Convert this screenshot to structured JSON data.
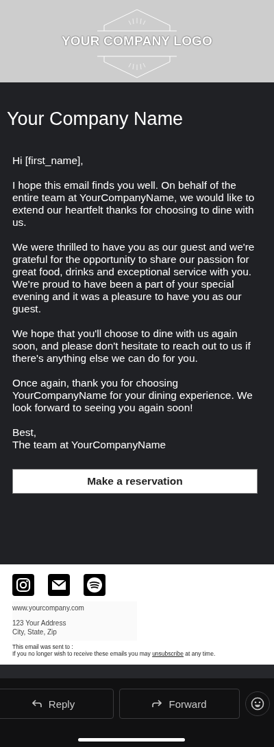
{
  "header": {
    "logo_text": "YOUR COMPANY LOGO"
  },
  "email": {
    "company_name": "Your Company Name",
    "paragraphs": [
      "Hi [first_name],",
      "I hope this email finds you well. On behalf of the entire team at YourCompanyName, we would like to extend our heartfelt thanks for choosing to dine with us.",
      "We were thrilled to have you as our guest and we're grateful for the opportunity to share our passion for great food, drinks and exceptional service with you. We're proud to have been a part of your special evening and it was a pleasure to have you as our guest.",
      "We hope that you'll choose to dine with us again soon, and please don't hesitate to reach out to us if there's anything else we can do for you.",
      "Once again, thank you for choosing YourCompanyName for your dining experience. We look forward to seeing you again soon!"
    ],
    "signoff": [
      "Best,",
      "The team at YourCompanyName"
    ],
    "cta": "Make a reservation"
  },
  "footer": {
    "social": [
      {
        "kind": "instagram"
      },
      {
        "kind": "mail"
      },
      {
        "kind": "spotify"
      }
    ],
    "website": "www.yourcompany.com",
    "address": [
      "123 Your Address",
      "City, State, Zip"
    ],
    "sent_to": "This email was sent to :",
    "unsubscribe_before": "If you no longer wish to receive these emails you may",
    "unsubscribe_link": "unsubscribe",
    "unsubscribe_after": "at any time."
  },
  "toolbar": {
    "buttons": [
      {
        "kind": "reply",
        "label": "Reply"
      },
      {
        "kind": "forward",
        "label": "Forward"
      }
    ]
  }
}
